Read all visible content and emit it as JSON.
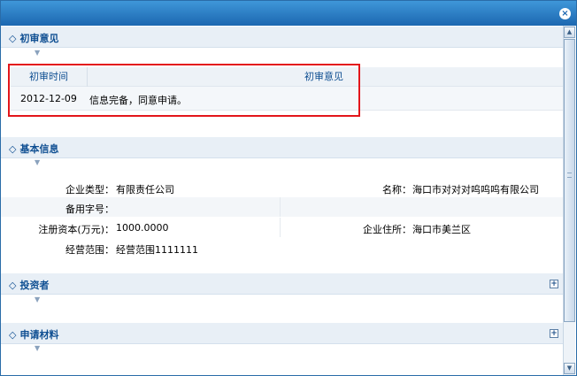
{
  "dialog": {
    "close_icon": "×"
  },
  "sections": {
    "review": {
      "title": "初审意见"
    },
    "basic": {
      "title": "基本信息"
    },
    "investors": {
      "title": "投资者"
    },
    "materials": {
      "title": "申请材料"
    }
  },
  "review_table": {
    "headers": [
      "初审时间",
      "初审意见"
    ],
    "rows": [
      {
        "date": "2012-12-09",
        "opinion": "信息完备，同意申请。"
      }
    ]
  },
  "basic_info": {
    "company_type_label": "企业类型：",
    "company_type_value": "有限责任公司",
    "name_label": "名称：",
    "name_value": "海口市对对对呜呜呜有限公司",
    "alt_name_label": "备用字号：",
    "alt_name_value": "",
    "capital_label": "注册资本(万元)：",
    "capital_value": "1000.0000",
    "address_label": "企业住所：",
    "address_value": "海口市美兰区",
    "scope_label": "经营范围：",
    "scope_value": "经营范围1111111"
  },
  "icons": {
    "diamond": "◇",
    "down_arrow": "▼",
    "expand": "+",
    "scroll_up": "▲",
    "scroll_down": "▼"
  },
  "colors": {
    "title_bar": "#1c67b0",
    "section_title": "#0f4f92",
    "highlight": "#e3161b"
  }
}
